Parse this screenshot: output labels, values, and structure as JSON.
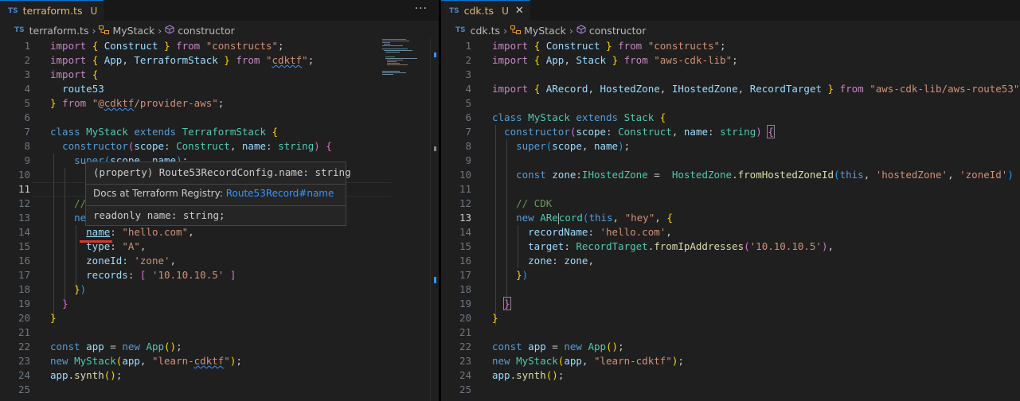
{
  "left": {
    "tab": {
      "lang": "TS",
      "filename": "terraform.ts",
      "status": "U"
    },
    "more_label": "···",
    "breadcrumb": {
      "file": "terraform.ts",
      "class": "MyStack",
      "method": "constructor"
    },
    "line_numbers": [
      "1",
      "2",
      "3",
      "4",
      "5",
      "6",
      "7",
      "8",
      "9",
      "10",
      "11",
      "12",
      "13",
      "14",
      "15",
      "16",
      "17",
      "18",
      "19",
      "20",
      "21",
      "22",
      "23",
      "24",
      "25"
    ],
    "hover": {
      "signature": "(property) Route53RecordConfig.name: string",
      "docs_prefix": "Docs at Terraform Registry: ",
      "docs_link": "Route53Record#name",
      "readonly": "readonly name: string;"
    }
  },
  "right": {
    "tab": {
      "lang": "TS",
      "filename": "cdk.ts",
      "status": "U",
      "close": "✕"
    },
    "breadcrumb": {
      "file": "cdk.ts",
      "class": "MyStack",
      "method": "constructor"
    },
    "line_numbers": [
      "1",
      "2",
      "3",
      "4",
      "5",
      "6",
      "7",
      "8",
      "9",
      "10",
      "11",
      "12",
      "13",
      "14",
      "15",
      "16",
      "17",
      "18",
      "19",
      "20",
      "21",
      "22",
      "23",
      "24",
      "25"
    ]
  },
  "colors": {
    "accent": "#0078d4",
    "annotation_red": "#d33a2c",
    "link": "#3794ff"
  }
}
